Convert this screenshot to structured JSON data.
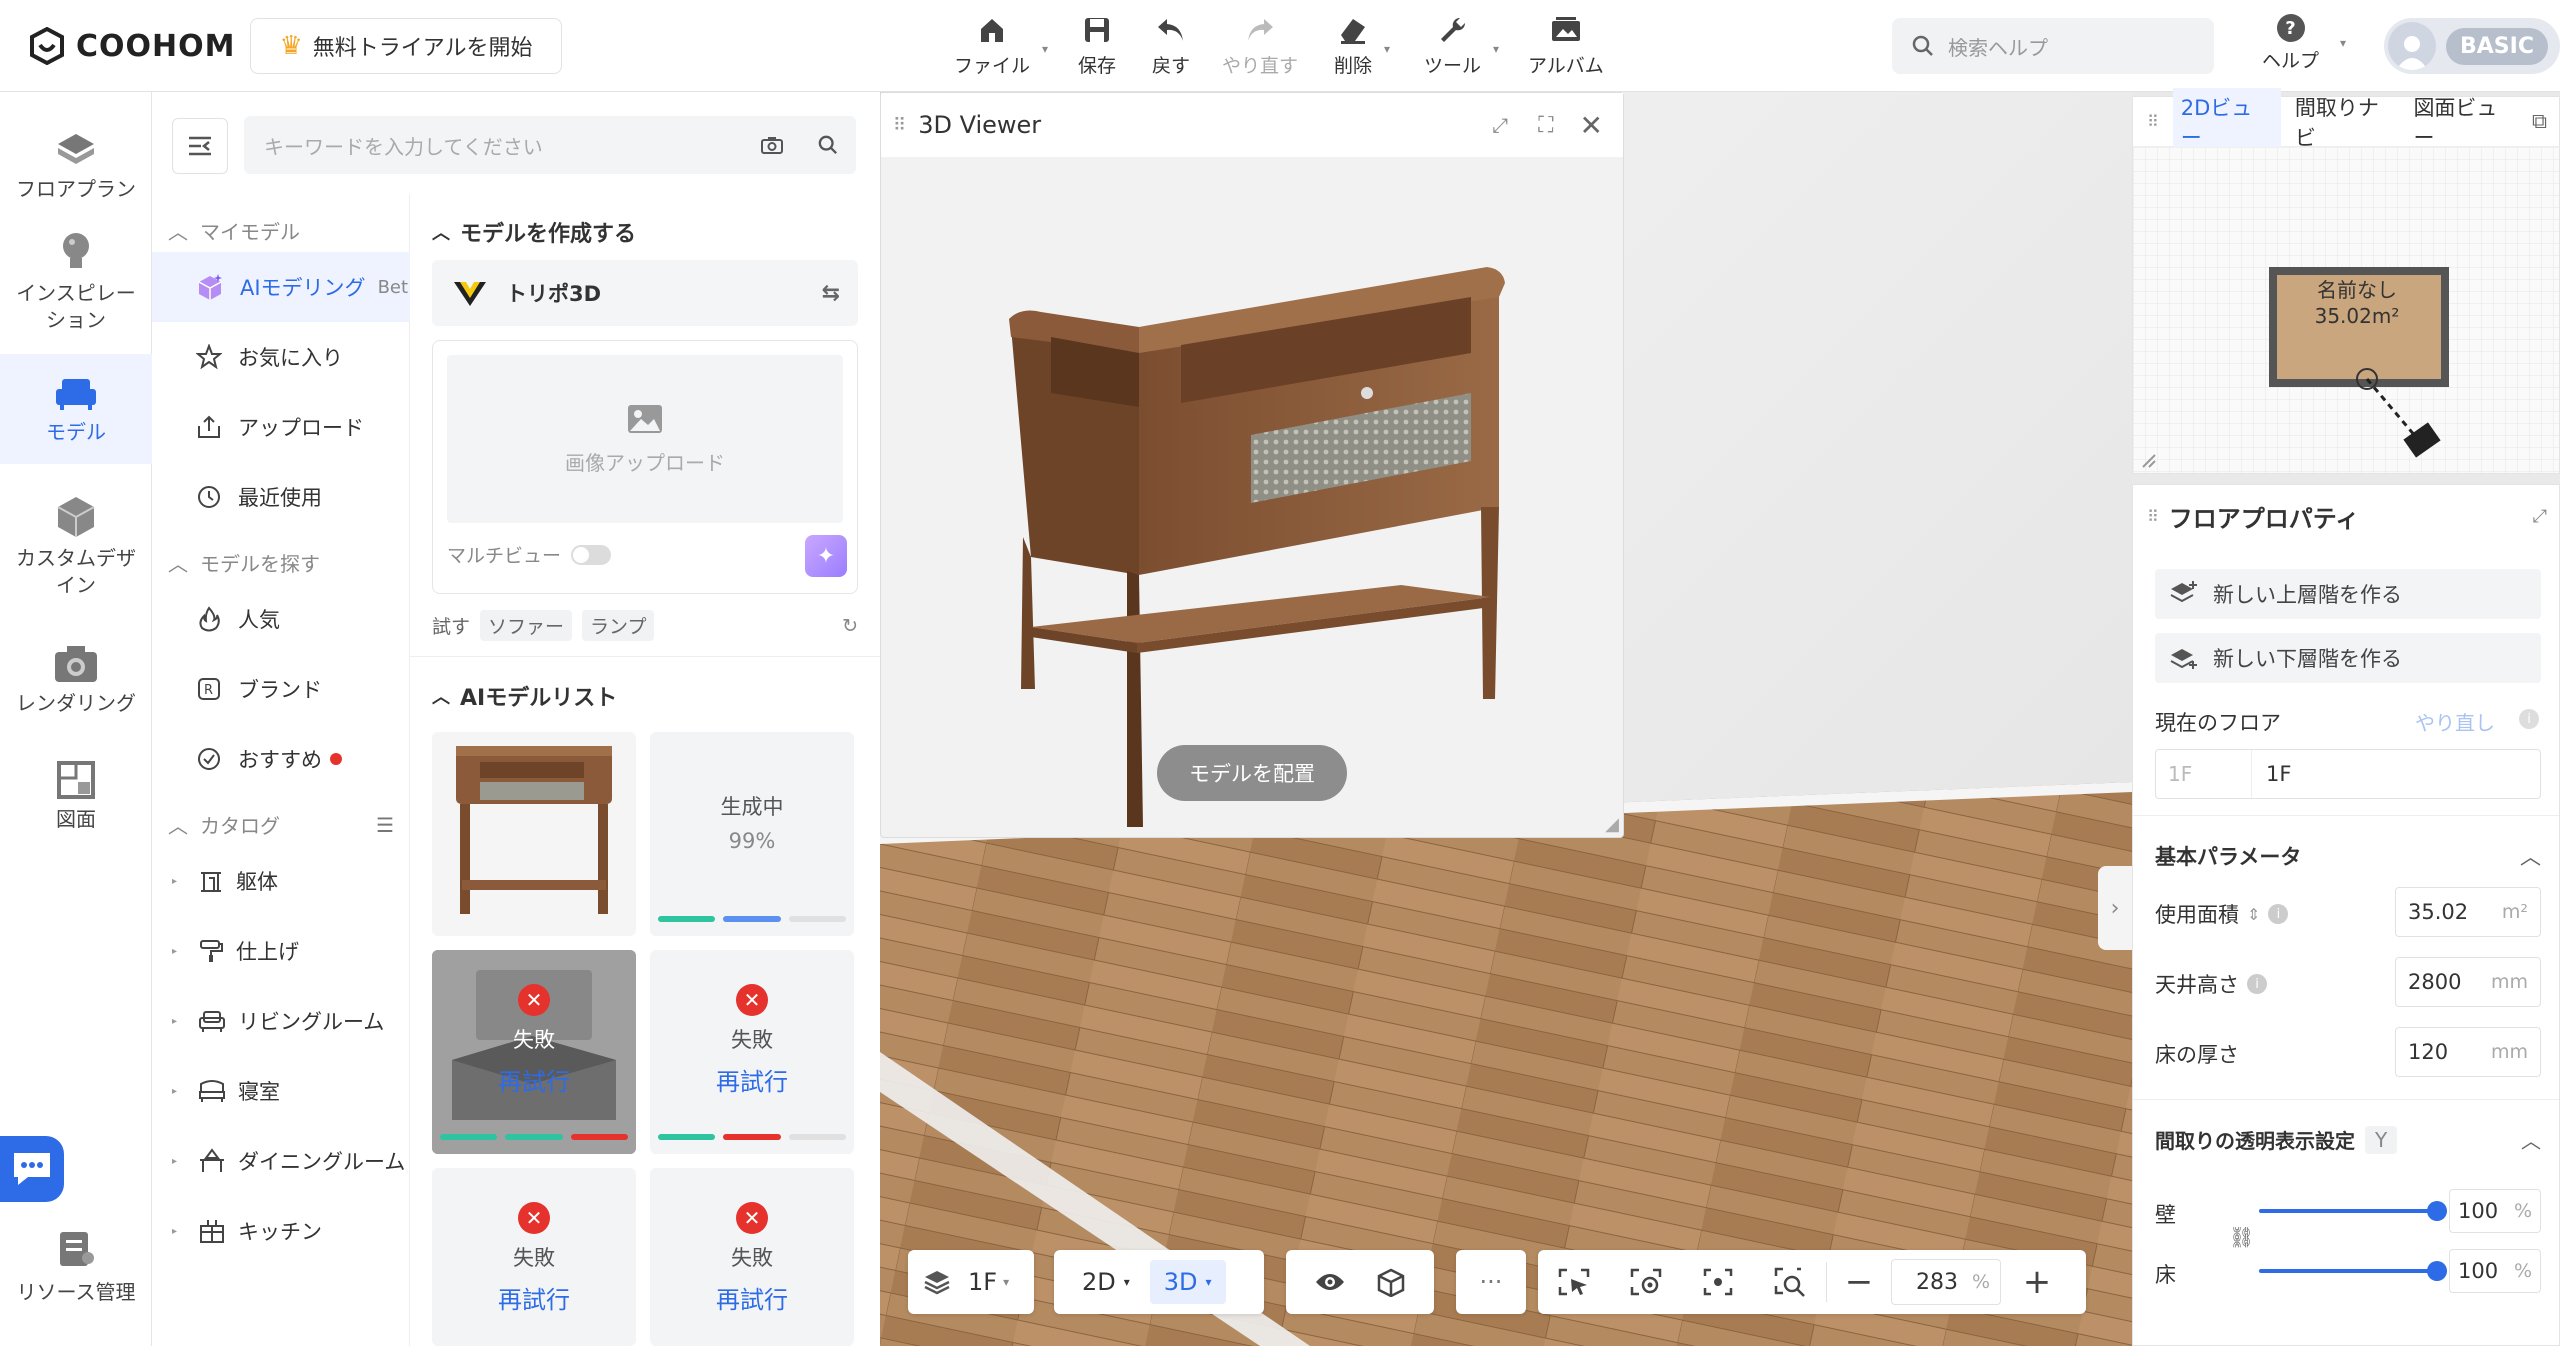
{
  "app": {
    "logo": "COOHOM",
    "trial": "無料トライアルを開始"
  },
  "toolbar": {
    "file": "ファイル",
    "save": "保存",
    "undo": "戻す",
    "redo": "やり直す",
    "delete": "削除",
    "tools": "ツール",
    "album": "アルバム"
  },
  "search": {
    "placeholder": "検索ヘルプ"
  },
  "help": {
    "label": "ヘルプ"
  },
  "user": {
    "plan": "BASIC"
  },
  "rail": {
    "floorplan": "フロアプラン",
    "inspiration": "インスピレーション",
    "model": "モデル",
    "custom": "カスタムデザイン",
    "rendering": "レンダリング",
    "drawing": "図面",
    "resource": "リソース管理"
  },
  "panel": {
    "keyword_placeholder": "キーワードを入力してください",
    "my_models": "マイモデル",
    "ai_modeling": "AIモデリング",
    "ai_beta": "Bet",
    "favorites": "お気に入り",
    "upload": "アップロード",
    "recent": "最近使用",
    "find_models": "モデルを探す",
    "popular": "人気",
    "brand": "ブランド",
    "recommended": "おすすめ",
    "catalog": "カタログ",
    "cat_structure": "躯体",
    "cat_finish": "仕上げ",
    "cat_living": "リビングルーム",
    "cat_bedroom": "寝室",
    "cat_dining": "ダイニングルーム",
    "cat_kitchen": "キッチン",
    "create_model": "モデルを作成する",
    "engine": "トリポ3D",
    "image_upload": "画像アップロード",
    "multiview": "マルチビュー",
    "try": "試す",
    "try_chip1": "ソファー",
    "try_chip2": "ランプ",
    "ai_list": "AIモデルリスト",
    "generating": "生成中",
    "progress": "99%",
    "failed": "失敗",
    "retry": "再試行"
  },
  "viewer": {
    "title": "3D Viewer",
    "place": "モデルを配置"
  },
  "minimap": {
    "tab_2d": "2Dビュー",
    "tab_nav": "間取りナビ",
    "tab_plan": "図面ビュー",
    "room_name": "名前なし",
    "room_area": "35.02m²"
  },
  "floor_props": {
    "title": "フロアプロパティ",
    "new_upper": "新しい上層階を作る",
    "new_lower": "新しい下層階を作る",
    "current_floor": "現在のフロア",
    "redo": "やり直し",
    "floor_prefix": "1F",
    "floor_name": "1F",
    "basic_params": "基本パラメータ",
    "area_label": "使用面積",
    "area_value": "35.02",
    "area_unit": "m²",
    "ceiling_label": "天井高さ",
    "ceiling_value": "2800",
    "ceiling_unit": "mm",
    "floor_thick_label": "床の厚さ",
    "floor_thick_value": "120",
    "floor_thick_unit": "mm",
    "transparency": "間取りの透明表示設定",
    "y_badge": "Y",
    "wall": "壁",
    "wall_value": "100",
    "floor": "床",
    "floor_value": "100",
    "pct": "%"
  },
  "bottom": {
    "floor": "1F",
    "mode2d": "2D",
    "mode3d": "3D",
    "more": "···",
    "zoom": "283",
    "zoom_unit": "%"
  },
  "colors": {
    "accent": "#2e6be6",
    "error": "#e5322d",
    "wood": "#8a5a3a"
  }
}
